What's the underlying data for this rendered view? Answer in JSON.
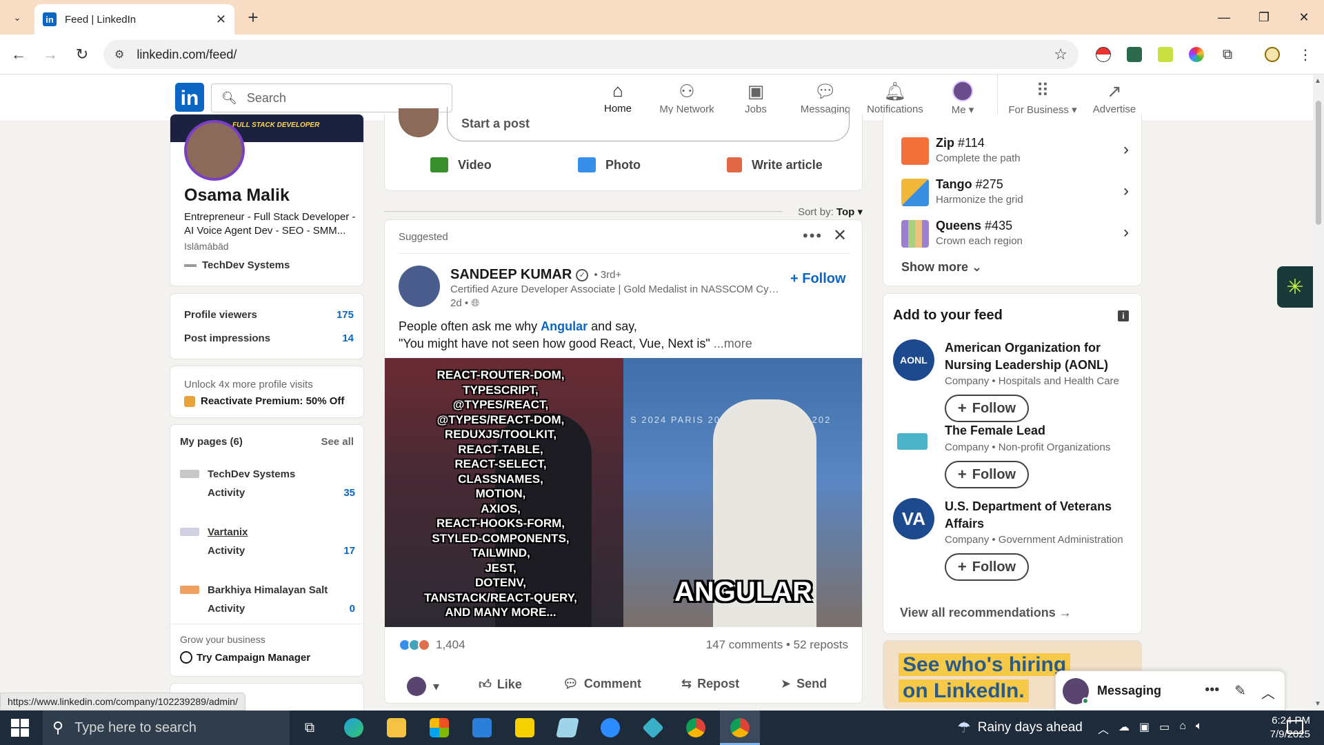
{
  "browser": {
    "tab_title": "Feed | LinkedIn",
    "url": "linkedin.com/feed/",
    "status_url": "https://www.linkedin.com/company/102239289/admin/"
  },
  "header": {
    "search_placeholder": "Search",
    "nav": [
      {
        "label": "Home",
        "icon": "home-icon"
      },
      {
        "label": "My Network",
        "icon": "network-icon"
      },
      {
        "label": "Jobs",
        "icon": "briefcase-icon"
      },
      {
        "label": "Messaging",
        "icon": "chat-icon"
      },
      {
        "label": "Notifications",
        "icon": "bell-icon"
      },
      {
        "label": "Me ▾",
        "icon": "avatar"
      },
      {
        "label": "For Business ▾",
        "icon": "grid-icon"
      },
      {
        "label": "Advertise",
        "icon": "advertise-icon"
      }
    ]
  },
  "profile": {
    "banner_tag": "FULL STACK DEVELOPER",
    "name": "Osama Malik",
    "headline": "Entrepreneur - Full Stack Developer - AI Voice Agent Dev - SEO - SMM...",
    "location": "Islāmābād",
    "company": "TechDev Systems"
  },
  "stats": {
    "viewers_label": "Profile viewers",
    "viewers_value": "175",
    "impressions_label": "Post impressions",
    "impressions_value": "14"
  },
  "premium": {
    "text": "Unlock 4x more profile visits",
    "link": "Reactivate Premium: 50% Off"
  },
  "pages": {
    "title": "My pages (6)",
    "see_all": "See all",
    "items": [
      {
        "name": "TechDev Systems",
        "activity": "Activity",
        "count": "35"
      },
      {
        "name": "Vartanix",
        "activity": "Activity",
        "count": "17"
      },
      {
        "name": "Barkhiya Himalayan Salt",
        "activity": "Activity",
        "count": "0"
      }
    ],
    "grow": "Grow your business",
    "campaign": "Try Campaign Manager"
  },
  "share": {
    "placeholder": "Start a post",
    "actions": [
      "Video",
      "Photo",
      "Write article"
    ]
  },
  "sort": {
    "label": "Sort by:",
    "value": "Top ▾"
  },
  "post": {
    "suggested": "Suggested",
    "author": "SANDEEP KUMAR",
    "degree": "• 3rd+",
    "title": "Certified Azure Developer Associate | Gold Medalist in NASSCOM Cybe...",
    "time": "2d •",
    "follow": "+ Follow",
    "text_1": "People often ask me why",
    "text_tag": "Angular",
    "text_2": "and say,",
    "text_3": "\"You might have not seen how good React, Vue, Next is\"",
    "text_more": "...more",
    "meme_lines": [
      "REACT-ROUTER-DOM,",
      "TYPESCRIPT,",
      "@TYPES/REACT,",
      "@TYPES/REACT-DOM,",
      "REDUXJS/TOOLKIT,",
      "REACT-TABLE,",
      "REACT-SELECT,",
      "CLASSNAMES,",
      "MOTION,",
      "AXIOS,",
      "REACT-HOOKS-FORM,",
      "STYLED-COMPONENTS,",
      "TAILWIND,",
      "JEST,",
      "DOTENV,",
      "TANSTACK/REACT-QUERY,",
      "AND MANY MORE..."
    ],
    "meme_right": "ANGULAR",
    "reactions": "1,404",
    "comments": "147 comments • 52 reposts",
    "actions": [
      "Like",
      "Comment",
      "Repost",
      "Send"
    ]
  },
  "games": [
    {
      "name": "Zip",
      "num": "#114",
      "sub": "Complete the path",
      "color": "#f2703a"
    },
    {
      "name": "Tango",
      "num": "#275",
      "sub": "Harmonize the grid",
      "color": "#f2b83a"
    },
    {
      "name": "Queens",
      "num": "#435",
      "sub": "Crown each region",
      "color": "#9b7fd0"
    }
  ],
  "games_show_more": "Show more ⌄",
  "feed_reco": {
    "title": "Add to your feed",
    "items": [
      {
        "name": "American Organization for Nursing Leadership (AONL)",
        "sub": "Company • Hospitals and Health Care",
        "logo": "AONL",
        "follow": "Follow"
      },
      {
        "name": "The Female Lead",
        "sub": "Company • Non-profit Organizations",
        "logo": "",
        "follow": "Follow"
      },
      {
        "name": "U.S. Department of Veterans Affairs",
        "sub": "Company • Government Administration",
        "logo": "VA",
        "follow": "Follow"
      }
    ],
    "view_all": "View all recommendations →"
  },
  "ad": {
    "line1": "See who's hiring",
    "line2": "on LinkedIn."
  },
  "messaging": {
    "label": "Messaging"
  },
  "taskbar": {
    "search_placeholder": "Type here to search",
    "weather": "Rainy days ahead",
    "time": "6:24 PM",
    "date": "7/9/2025"
  }
}
